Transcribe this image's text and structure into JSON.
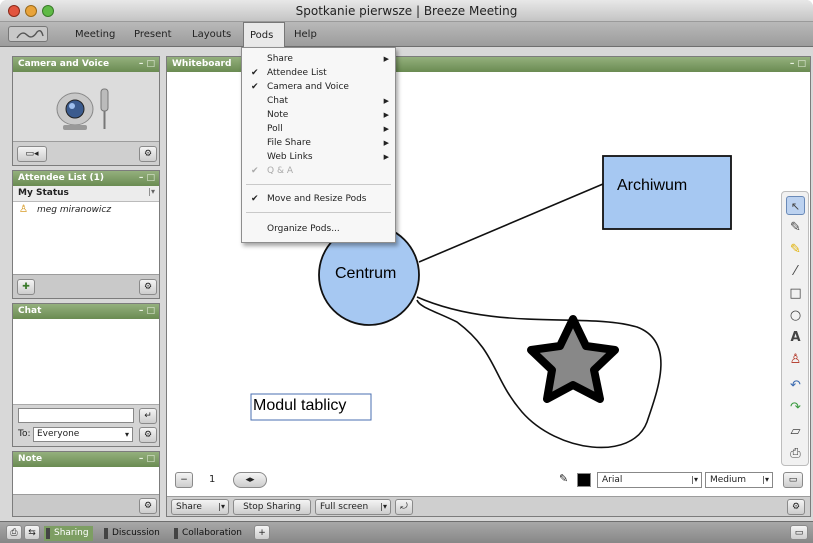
{
  "window": {
    "title": "Spotkanie pierwsze | Breeze Meeting"
  },
  "menubar": {
    "items": [
      "Meeting",
      "Present",
      "Layouts",
      "Pods",
      "Help"
    ]
  },
  "pods_menu": {
    "items": [
      {
        "label": "Share",
        "checked": false,
        "submenu": true,
        "disabled": false
      },
      {
        "label": "Attendee List",
        "checked": true,
        "submenu": false,
        "disabled": false
      },
      {
        "label": "Camera and Voice",
        "checked": true,
        "submenu": false,
        "disabled": false
      },
      {
        "label": "Chat",
        "checked": false,
        "submenu": true,
        "disabled": false
      },
      {
        "label": "Note",
        "checked": false,
        "submenu": true,
        "disabled": false
      },
      {
        "label": "Poll",
        "checked": false,
        "submenu": true,
        "disabled": false
      },
      {
        "label": "File Share",
        "checked": false,
        "submenu": true,
        "disabled": false
      },
      {
        "label": "Web Links",
        "checked": false,
        "submenu": true,
        "disabled": false
      },
      {
        "label": "Q & A",
        "checked": true,
        "submenu": false,
        "disabled": true
      },
      {
        "label": "Move and Resize Pods",
        "checked": true,
        "submenu": false,
        "disabled": false
      },
      {
        "label": "Organize Pods...",
        "checked": false,
        "submenu": false,
        "disabled": false
      }
    ]
  },
  "camera_pod": {
    "title": "Camera and Voice",
    "controls": "– □"
  },
  "attendee_pod": {
    "title": "Attendee List (1)",
    "status_label": "My Status",
    "attendees": [
      "meg miranowicz"
    ],
    "controls": "– □"
  },
  "chat_pod": {
    "title": "Chat",
    "to_label": "To:",
    "to_value": "Everyone",
    "controls": "– □"
  },
  "note_pod": {
    "title": "Note",
    "controls": "– □"
  },
  "whiteboard": {
    "title": "Whiteboard",
    "controls": "– □",
    "shapes": {
      "archive_label": "Archiwum",
      "center_label": "Centrum",
      "text_box": "Modul tablicy"
    },
    "page_number": "1",
    "font_name": "Arial",
    "font_size": "Medium"
  },
  "share_bar": {
    "share_label": "Share",
    "stop_label": "Stop Sharing",
    "fullscreen_label": "Full screen"
  },
  "tabs": [
    "Sharing",
    "Discussion",
    "Collaboration",
    "+"
  ],
  "colors": {
    "pod_header": "#7c9b63",
    "shape_fill": "#a6c8f2",
    "accent_title": "#ffffff"
  }
}
